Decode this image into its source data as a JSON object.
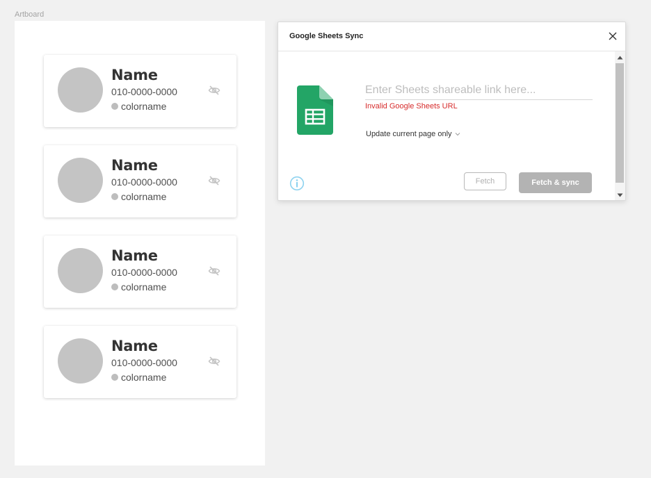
{
  "canvas": {
    "artboard_label": "Artboard"
  },
  "cards": [
    {
      "name": "Name",
      "phone": "010-0000-0000",
      "color_name": "colorname",
      "icon": "eye-off-icon"
    },
    {
      "name": "Name",
      "phone": "010-0000-0000",
      "color_name": "colorname",
      "icon": "eye-off-icon"
    },
    {
      "name": "Name",
      "phone": "010-0000-0000",
      "color_name": "colorname",
      "icon": "eye-off-icon"
    },
    {
      "name": "Name",
      "phone": "010-0000-0000",
      "color_name": "colorname",
      "icon": "eye-off-icon"
    }
  ],
  "dialog": {
    "title": "Google Sheets Sync",
    "close_icon": "close-icon",
    "sheets_icon": "google-sheets-icon",
    "link_input": {
      "value": "",
      "placeholder": "Enter Sheets shareable link here..."
    },
    "error_message": "Invalid Google Sheets URL",
    "scope_select": {
      "selected": "Update current page only",
      "icon": "chevron-down-icon"
    },
    "info_icon": "info-icon",
    "fetch_label": "Fetch",
    "fetch_sync_label": "Fetch & sync"
  },
  "colors": {
    "canvas_bg": "#f1f1f1",
    "avatar": "#c4c4c4",
    "error": "#d62b2b",
    "sheets_green": "#23a566",
    "button_disabled": "#b3b3b3",
    "info_blue": "#8dd2ef"
  }
}
